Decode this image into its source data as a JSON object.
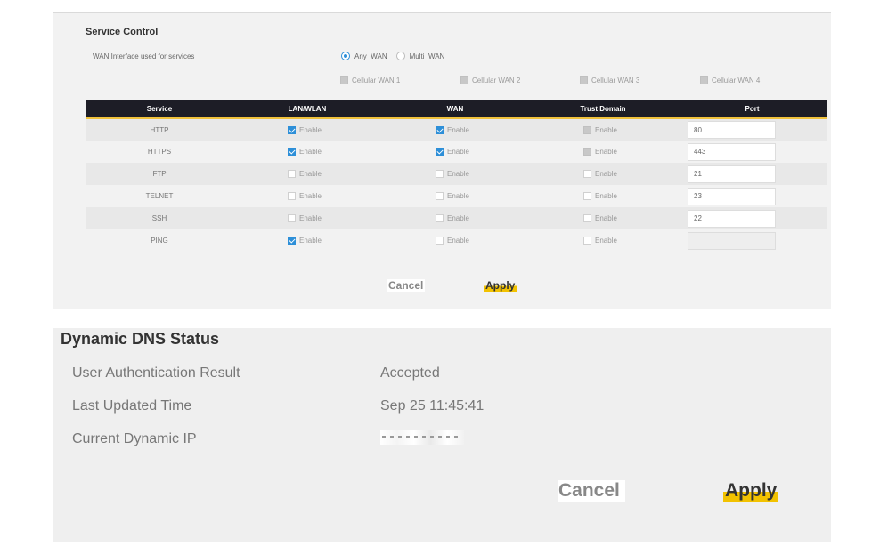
{
  "service_control": {
    "title": "Service Control",
    "wan_interface_label": "WAN Interface used for services",
    "radio_options": [
      {
        "label": "Any_WAN",
        "selected": true
      },
      {
        "label": "Multi_WAN",
        "selected": false
      }
    ],
    "cellular_options": [
      {
        "label": "Cellular WAN 1",
        "checked": false
      },
      {
        "label": "Cellular WAN 2",
        "checked": false
      },
      {
        "label": "Cellular WAN 3",
        "checked": false
      },
      {
        "label": "Cellular WAN 4",
        "checked": false
      }
    ],
    "columns": [
      "Service",
      "LAN/WLAN",
      "WAN",
      "Trust Domain",
      "Port"
    ],
    "rows": [
      {
        "service": "HTTP",
        "lan": {
          "label": "Enable",
          "checked": true
        },
        "wan": {
          "label": "Enable",
          "checked": true
        },
        "trust": {
          "label": "Enable",
          "state": "grey"
        },
        "port": "80"
      },
      {
        "service": "HTTPS",
        "lan": {
          "label": "Enable",
          "checked": true
        },
        "wan": {
          "label": "Enable",
          "checked": true
        },
        "trust": {
          "label": "Enable",
          "state": "grey"
        },
        "port": "443"
      },
      {
        "service": "FTP",
        "lan": {
          "label": "Enable",
          "checked": false
        },
        "wan": {
          "label": "Enable",
          "checked": false
        },
        "trust": {
          "label": "Enable",
          "state": "off"
        },
        "port": "21"
      },
      {
        "service": "TELNET",
        "lan": {
          "label": "Enable",
          "checked": false
        },
        "wan": {
          "label": "Enable",
          "checked": false
        },
        "trust": {
          "label": "Enable",
          "state": "off"
        },
        "port": "23"
      },
      {
        "service": "SSH",
        "lan": {
          "label": "Enable",
          "checked": false
        },
        "wan": {
          "label": "Enable",
          "checked": false
        },
        "trust": {
          "label": "Enable",
          "state": "off"
        },
        "port": "22"
      },
      {
        "service": "PING",
        "lan": {
          "label": "Enable",
          "checked": true
        },
        "wan": {
          "label": "Enable",
          "checked": false
        },
        "trust": {
          "label": "Enable",
          "state": "off"
        },
        "port": ""
      }
    ],
    "cancel_label": "Cancel",
    "apply_label": "Apply"
  },
  "dynamic_dns": {
    "title": "Dynamic DNS Status",
    "rows": [
      {
        "label": "User Authentication Result",
        "value": "Accepted"
      },
      {
        "label": "Last Updated Time",
        "value": "Sep 25 11:45:41"
      },
      {
        "label": "Current Dynamic IP",
        "value": ""
      }
    ],
    "cancel_label": "Cancel",
    "apply_label": "Apply"
  },
  "colors": {
    "accent": "#f2c200",
    "checkbox_checked": "#2d8fd8",
    "table_header": "#1d1d26"
  }
}
